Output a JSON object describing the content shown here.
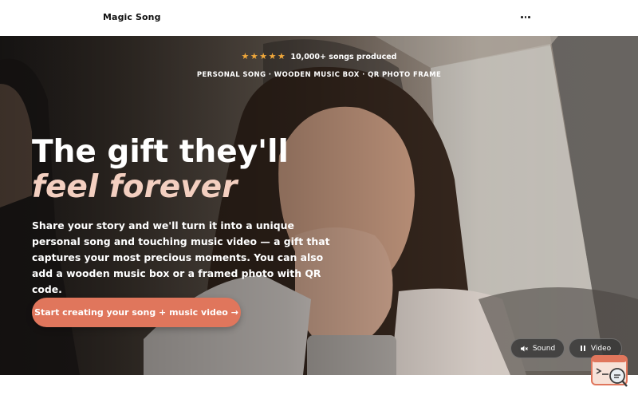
{
  "header": {
    "brand": "Magic Song",
    "menu_icon": "more-horizontal-icon"
  },
  "hero": {
    "rating": {
      "stars": "★★★★★",
      "text": "10,000+ songs produced"
    },
    "tagline": "PERSONAL SONG · WOODEN MUSIC BOX · QR PHOTO FRAME",
    "headline_line1": "The gift they'll",
    "headline_line2": "feel forever",
    "description": "Share your story and we'll turn it into a unique personal song and touching music video — a gift that captures your most precious moments. You can also add a wooden music box or a framed photo with QR code.",
    "cta_label": "Start creating your song + music video →",
    "sound_label": "Sound",
    "video_label": "Video"
  },
  "colors": {
    "accent": "#e0765c",
    "headline_accent": "#f3cfc0",
    "star": "#f2a93b"
  }
}
